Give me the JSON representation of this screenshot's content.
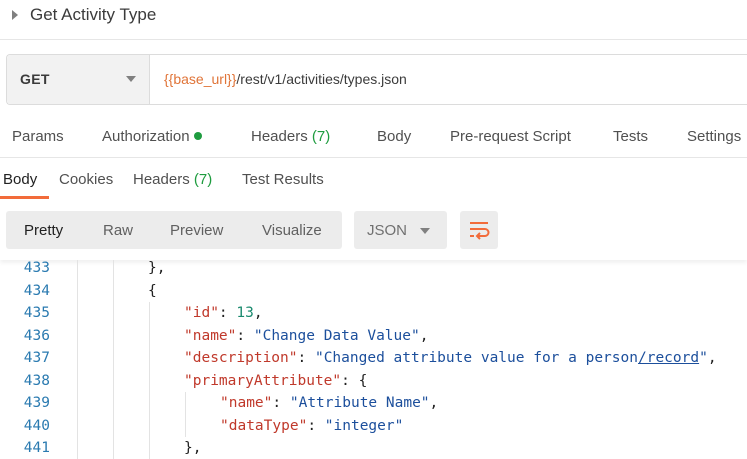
{
  "request_title": "Get Activity Type",
  "request": {
    "method": "GET",
    "url_variable": "{{base_url}}",
    "url_path": "/rest/v1/activities/types.json"
  },
  "request_tabs": [
    {
      "label": "Params"
    },
    {
      "label": "Authorization"
    },
    {
      "label": "Headers",
      "count": "(7)"
    },
    {
      "label": "Body"
    },
    {
      "label": "Pre-request Script"
    },
    {
      "label": "Tests"
    },
    {
      "label": "Settings"
    }
  ],
  "response_tabs": [
    {
      "label": "Body",
      "active": true
    },
    {
      "label": "Cookies"
    },
    {
      "label": "Headers",
      "count": "(7)"
    },
    {
      "label": "Test Results"
    }
  ],
  "view_modes": [
    {
      "label": "Pretty",
      "active": true
    },
    {
      "label": "Raw"
    },
    {
      "label": "Preview"
    },
    {
      "label": "Visualize"
    }
  ],
  "language_select": "JSON",
  "code": {
    "line_numbers": [
      "433",
      "434",
      "435",
      "436",
      "437",
      "438",
      "439",
      "440",
      "441"
    ],
    "lines": {
      "l433": "},",
      "l434": "{",
      "id_key": "\"id\"",
      "id_val": "13",
      "name_key": "\"name\"",
      "name_val": "\"Change Data Value\"",
      "desc_key": "\"description\"",
      "desc_val_a": "\"Changed attribute value for a person",
      "desc_val_b": "/record",
      "desc_val_c": "\"",
      "prim_key": "\"primaryAttribute\"",
      "attr_name_key": "\"name\"",
      "attr_name_val": "\"Attribute Name\"",
      "datatype_key": "\"dataType\"",
      "datatype_val": "\"integer\"",
      "l441": "},"
    }
  },
  "colors": {
    "accent": "#f26b3a",
    "url_variable": "#e07438",
    "count_green": "#1e9c3f",
    "json_key": "#c0392b",
    "json_string": "#1c4f9c",
    "json_number": "#1a8a6e",
    "line_number": "#2a7ab0"
  }
}
